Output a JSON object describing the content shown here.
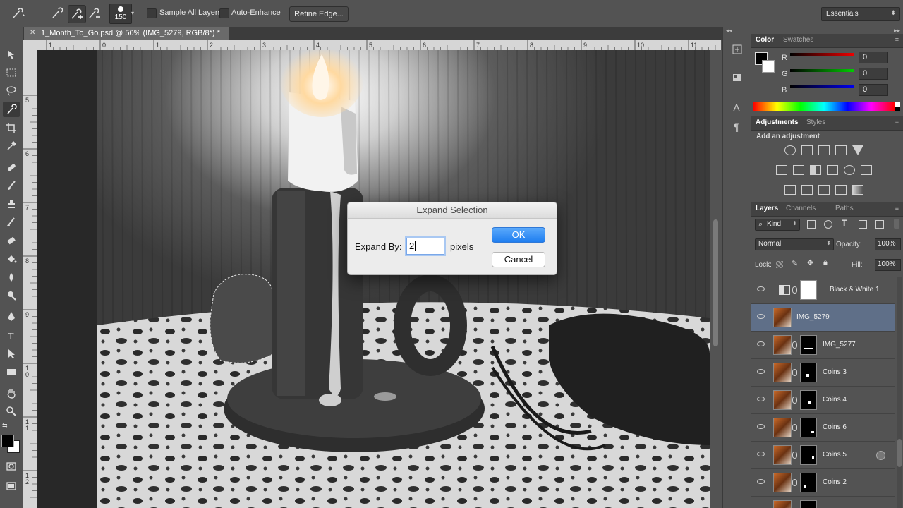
{
  "options_bar": {
    "brush_size": "150",
    "sample_all_layers": "Sample All Layers",
    "auto_enhance": "Auto-Enhance",
    "refine_edge": "Refine Edge...",
    "workspace": "Essentials"
  },
  "document": {
    "tab_title": "1_Month_To_Go.psd @ 50% (IMG_5279, RGB/8*) *",
    "ruler_h": [
      "1",
      "0",
      "1",
      "2",
      "3",
      "4",
      "5",
      "6",
      "7",
      "8",
      "9",
      "10",
      "11"
    ],
    "ruler_v": [
      "5",
      "6",
      "7",
      "8",
      "9",
      "1\n0",
      "1\n1",
      "1\n2"
    ]
  },
  "dialog": {
    "title": "Expand Selection",
    "label": "Expand By:",
    "value": "2",
    "unit": "pixels",
    "ok": "OK",
    "cancel": "Cancel"
  },
  "color_panel": {
    "tabs": [
      "Color",
      "Swatches"
    ],
    "r_label": "R",
    "g_label": "G",
    "b_label": "B",
    "r": "0",
    "g": "0",
    "b": "0"
  },
  "adjustments_panel": {
    "tabs": [
      "Adjustments",
      "Styles"
    ],
    "subtitle": "Add an adjustment"
  },
  "layers_panel": {
    "tabs": [
      "Layers",
      "Channels",
      "Paths"
    ],
    "filter": "Kind",
    "blend_mode": "Normal",
    "opacity_label": "Opacity:",
    "opacity": "100%",
    "lock_label": "Lock:",
    "fill_label": "Fill:",
    "fill": "100%",
    "layers": [
      {
        "name": "Black & White 1"
      },
      {
        "name": "IMG_5279"
      },
      {
        "name": "IMG_5277"
      },
      {
        "name": "Coins 3"
      },
      {
        "name": "Coins 4"
      },
      {
        "name": "Coins 6"
      },
      {
        "name": "Coins 5"
      },
      {
        "name": "Coins 2"
      }
    ]
  },
  "colors": {
    "ok_blue": "#2f8df5",
    "selected_layer": "#5f6f88",
    "panel_bg": "#535353"
  }
}
